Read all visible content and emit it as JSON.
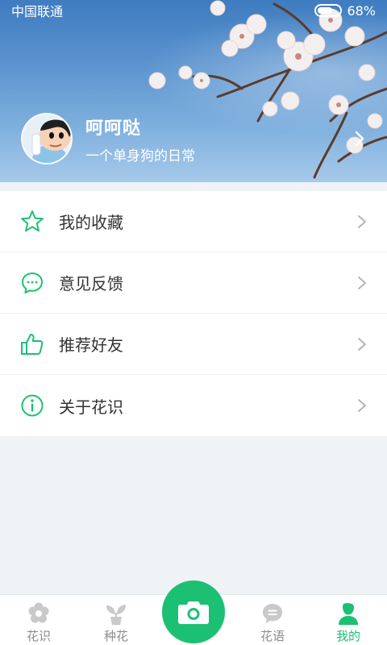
{
  "status_bar": {
    "carrier": "中国联通",
    "battery": "68%"
  },
  "profile": {
    "nickname": "呵呵哒",
    "bio": "一个单身狗的日常"
  },
  "menu": {
    "items": [
      {
        "label": "我的收藏",
        "icon": "star-icon"
      },
      {
        "label": "意见反馈",
        "icon": "chat-bubble-icon"
      },
      {
        "label": "推荐好友",
        "icon": "thumbs-up-icon"
      },
      {
        "label": "关于花识",
        "icon": "info-icon"
      }
    ]
  },
  "bottom_nav": {
    "items": [
      {
        "label": "花识",
        "icon": "flower-icon",
        "active": false
      },
      {
        "label": "种花",
        "icon": "sprout-icon",
        "active": false
      },
      {
        "label": "花语",
        "icon": "message-icon",
        "active": false
      },
      {
        "label": "我的",
        "icon": "user-icon",
        "active": true
      }
    ],
    "camera_icon": "camera-icon"
  },
  "colors": {
    "accent": "#1bc073",
    "inactive": "#8c8c8c",
    "background": "#f0f3f6"
  }
}
